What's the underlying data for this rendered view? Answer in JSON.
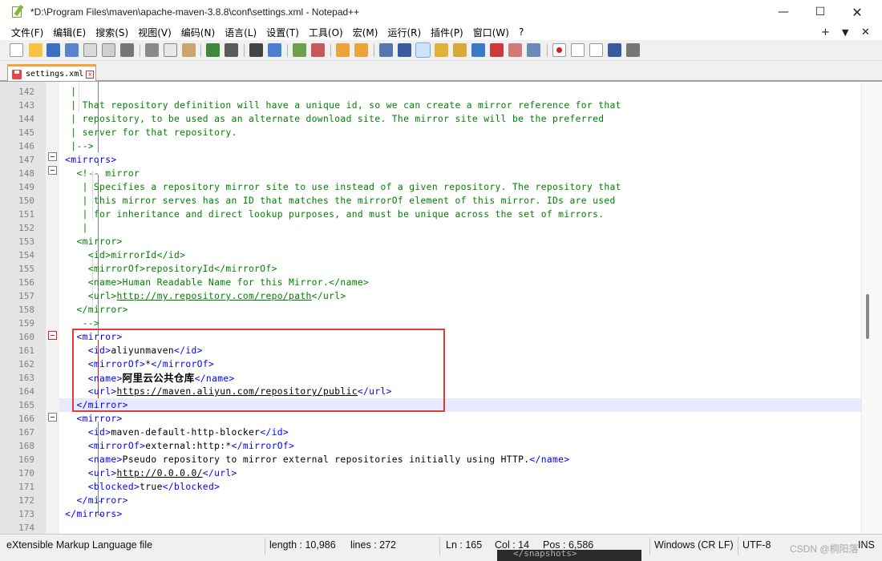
{
  "window": {
    "title": "*D:\\Program Files\\maven\\apache-maven-3.8.8\\conf\\settings.xml - Notepad++",
    "minimize": "—",
    "maximize": "☐",
    "close": "✕"
  },
  "menu": {
    "items": [
      "文件(F)",
      "编辑(E)",
      "搜索(S)",
      "视图(V)",
      "编码(N)",
      "语言(L)",
      "设置(T)",
      "工具(O)",
      "宏(M)",
      "运行(R)",
      "插件(P)",
      "窗口(W)",
      "?"
    ],
    "right": {
      "plus": "+",
      "down": "▼",
      "close": "✕"
    }
  },
  "tab": {
    "label": "settings.xml",
    "close": "x"
  },
  "editor": {
    "lines": [
      {
        "n": "142",
        "html": "<span class='c'>  |</span>"
      },
      {
        "n": "143",
        "html": "<span class='c'>  | That repository definition will have a unique id, so we can create a mirror reference for that</span>"
      },
      {
        "n": "144",
        "html": "<span class='c'>  | repository, to be used as an alternate download site. The mirror site will be the preferred</span>"
      },
      {
        "n": "145",
        "html": "<span class='c'>  | server for that repository.</span>"
      },
      {
        "n": "146",
        "html": "<span class='c'>  |--></span>"
      },
      {
        "n": "147",
        "html": "<span class='t'> &lt;mirrors&gt;</span>"
      },
      {
        "n": "148",
        "html": "<span class='c'>   &lt;!-- mirror</span>"
      },
      {
        "n": "149",
        "html": "<span class='c'>    | Specifies a repository mirror site to use instead of a given repository. The repository that</span>"
      },
      {
        "n": "150",
        "html": "<span class='c'>    | this mirror serves has an ID that matches the mirrorOf element of this mirror. IDs are used</span>"
      },
      {
        "n": "151",
        "html": "<span class='c'>    | for inheritance and direct lookup purposes, and must be unique across the set of mirrors.</span>"
      },
      {
        "n": "152",
        "html": "<span class='c'>    |</span>"
      },
      {
        "n": "153",
        "html": "<span class='c'>   &lt;mirror&gt;</span>"
      },
      {
        "n": "154",
        "html": "<span class='c'>     &lt;id&gt;mirrorId&lt;/id&gt;</span>"
      },
      {
        "n": "155",
        "html": "<span class='c'>     &lt;mirrorOf&gt;repositoryId&lt;/mirrorOf&gt;</span>"
      },
      {
        "n": "156",
        "html": "<span class='c'>     &lt;name&gt;Human Readable Name for this Mirror.&lt;/name&gt;</span>"
      },
      {
        "n": "157",
        "html": "<span class='c'>     &lt;url&gt;<u>http://my.repository.com/repo/path</u>&lt;/url&gt;</span>"
      },
      {
        "n": "158",
        "html": "<span class='c'>   &lt;/mirror&gt;</span>"
      },
      {
        "n": "159",
        "html": "<span class='c'>    --></span>"
      },
      {
        "n": "160",
        "html": "<span class='t'>   &lt;mirror&gt;</span>"
      },
      {
        "n": "161",
        "html": "<span class='t'>     &lt;id&gt;</span><span class='k'>aliyunmaven</span><span class='t'>&lt;/id&gt;</span>"
      },
      {
        "n": "162",
        "html": "<span class='t'>     &lt;mirrorOf&gt;</span><span class='k'>*</span><span class='t'>&lt;/mirrorOf&gt;</span>"
      },
      {
        "n": "163",
        "html": "<span class='t'>     &lt;name&gt;</span><span class='cjk'>阿里云公共仓库</span><span class='t'>&lt;/name&gt;</span>"
      },
      {
        "n": "164",
        "html": "<span class='t'>     &lt;url&gt;</span><span class='u'>https://maven.aliyun.com/repository/public</span><span class='t'>&lt;/url&gt;</span>"
      },
      {
        "n": "165",
        "html": "<span class='t'>   &lt;/mirror&gt;</span>"
      },
      {
        "n": "166",
        "html": "<span class='t'>   &lt;mirror&gt;</span>"
      },
      {
        "n": "167",
        "html": "<span class='t'>     &lt;id&gt;</span><span class='k'>maven-default-http-blocker</span><span class='t'>&lt;/id&gt;</span>"
      },
      {
        "n": "168",
        "html": "<span class='t'>     &lt;mirrorOf&gt;</span><span class='k'>external:http:*</span><span class='t'>&lt;/mirrorOf&gt;</span>"
      },
      {
        "n": "169",
        "html": "<span class='t'>     &lt;name&gt;</span><span class='k'>Pseudo repository to mirror external repositories initially using HTTP.</span><span class='t'>&lt;/name&gt;</span>"
      },
      {
        "n": "170",
        "html": "<span class='t'>     &lt;url&gt;</span><span class='u'>http://0.0.0.0/</span><span class='t'>&lt;/url&gt;</span>"
      },
      {
        "n": "171",
        "html": "<span class='t'>     &lt;blocked&gt;</span><span class='k'>true</span><span class='t'>&lt;/blocked&gt;</span>"
      },
      {
        "n": "172",
        "html": "<span class='t'>   &lt;/mirror&gt;</span>"
      },
      {
        "n": "173",
        "html": "<span class='t'> &lt;/mirrors&gt;</span>"
      },
      {
        "n": "174",
        "html": ""
      }
    ],
    "current_line": "165"
  },
  "status": {
    "filetype": "eXtensible Markup Language file",
    "length": "length : 10,986",
    "lines": "lines : 272",
    "ln": "Ln : 165",
    "col": "Col : 14",
    "pos": "Pos : 6,586",
    "eol": "Windows (CR LF)",
    "encoding": "UTF-8",
    "ins": "INS",
    "watermark": "CSDN @桐阳落"
  },
  "background_snapshot": "</snapshots>",
  "colors": {
    "comment": "#008000",
    "tag": "#0000ff",
    "highlight_box": "#e03b3b",
    "current_line": "#e8e8ff",
    "tab_accent": "#f7a23a"
  }
}
